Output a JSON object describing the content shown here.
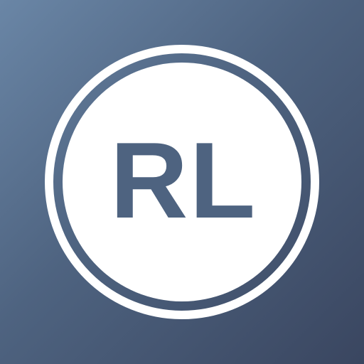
{
  "app_icon": {
    "monogram": "RL",
    "background_gradient": [
      "#6a86a6",
      "#4e6380",
      "#3a4660"
    ],
    "ring_color": "#ffffff",
    "disc_color": "#ffffff",
    "monogram_color": "#4e6380"
  }
}
